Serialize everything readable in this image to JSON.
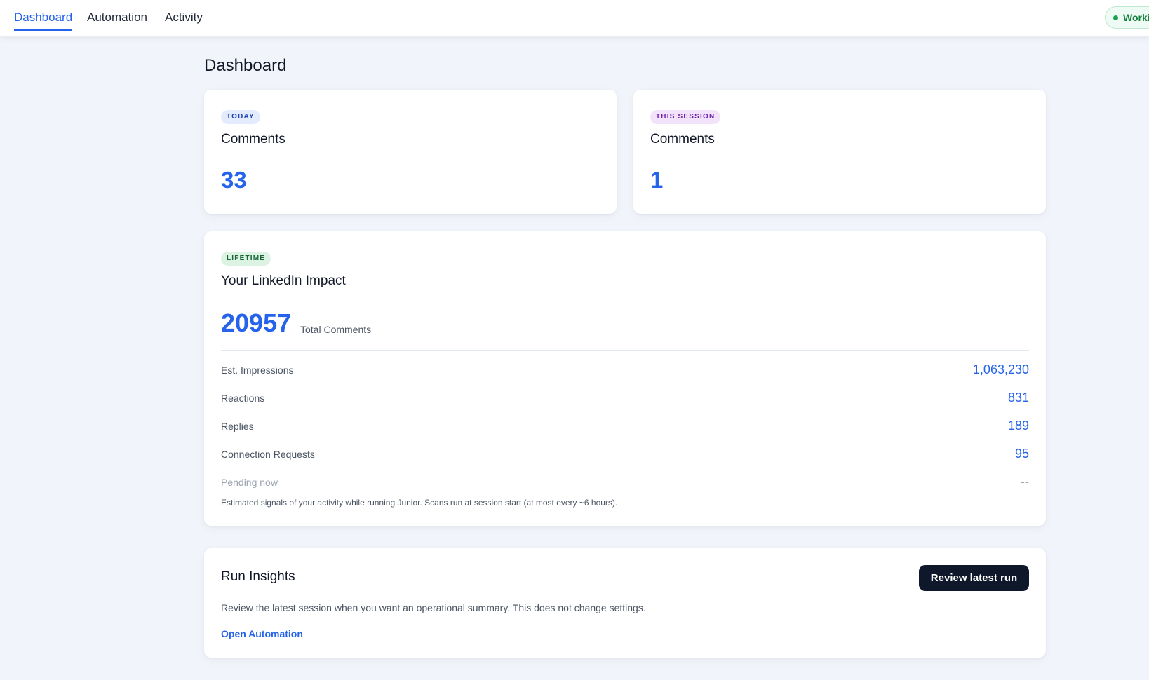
{
  "nav": {
    "tabs": [
      {
        "label": "Dashboard",
        "active": true
      },
      {
        "label": "Automation",
        "active": false
      },
      {
        "label": "Activity",
        "active": false
      }
    ],
    "status": {
      "label": "Working",
      "color": "#16a34a"
    }
  },
  "page": {
    "title": "Dashboard"
  },
  "today_card": {
    "badge": "TODAY",
    "title": "Comments",
    "value": "33"
  },
  "session_card": {
    "badge": "THIS SESSION",
    "title": "Comments",
    "value": "1"
  },
  "impact_card": {
    "badge": "LIFETIME",
    "title": "Your LinkedIn Impact",
    "total_value": "20957",
    "total_label": "Total Comments",
    "stats": [
      {
        "label": "Est. Impressions",
        "value": "1,063,230"
      },
      {
        "label": "Reactions",
        "value": "831"
      },
      {
        "label": "Replies",
        "value": "189"
      },
      {
        "label": "Connection Requests",
        "value": "95"
      },
      {
        "label": "Pending now",
        "value": "--"
      }
    ],
    "footnote": "Estimated signals of your activity while running Junior. Scans run at session start (at most every ~6 hours)."
  },
  "insights_card": {
    "title": "Run Insights",
    "button_label": "Review latest run",
    "description": "Review the latest session when you want an operational summary. This does not change settings.",
    "link_label": "Open Automation"
  },
  "colors": {
    "accent": "#2563eb",
    "background": "#f1f4fa",
    "primary_button": "#0f172a",
    "status_green": "#16a34a"
  }
}
